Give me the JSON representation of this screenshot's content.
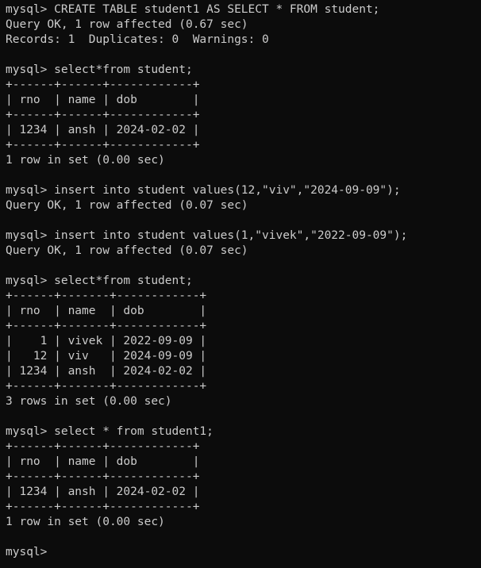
{
  "terminal": {
    "background": "#0c0c0c",
    "foreground": "#cccccc",
    "lines": [
      "mysql> CREATE TABLE student1 AS SELECT * FROM student;",
      "Query OK, 1 row affected (0.67 sec)",
      "Records: 1  Duplicates: 0  Warnings: 0",
      "",
      "mysql> select*from student;",
      "+------+------+------------+",
      "| rno  | name | dob        |",
      "+------+------+------------+",
      "| 1234 | ansh | 2024-02-02 |",
      "+------+------+------------+",
      "1 row in set (0.00 sec)",
      "",
      "mysql> insert into student values(12,\"viv\",\"2024-09-09\");",
      "Query OK, 1 row affected (0.07 sec)",
      "",
      "mysql> insert into student values(1,\"vivek\",\"2022-09-09\");",
      "Query OK, 1 row affected (0.07 sec)",
      "",
      "mysql> select*from student;",
      "+------+-------+------------+",
      "| rno  | name  | dob        |",
      "+------+-------+------------+",
      "|    1 | vivek | 2022-09-09 |",
      "|   12 | viv   | 2024-09-09 |",
      "| 1234 | ansh  | 2024-02-02 |",
      "+------+-------+------------+",
      "3 rows in set (0.00 sec)",
      "",
      "mysql> select * from student1;",
      "+------+------+------------+",
      "| rno  | name | dob        |",
      "+------+------+------------+",
      "| 1234 | ansh | 2024-02-02 |",
      "+------+------+------------+",
      "1 row in set (0.00 sec)",
      "",
      "mysql> "
    ]
  }
}
